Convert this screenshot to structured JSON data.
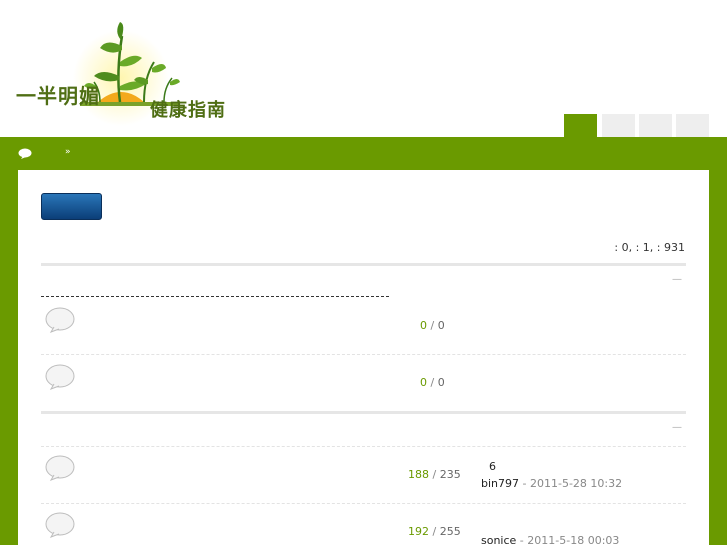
{
  "logo": {
    "text_primary": "一半明媚",
    "text_secondary": "健康指南"
  },
  "nav": {
    "separator": "»"
  },
  "stats": {
    "text": ": 0,   : 1,   : 931"
  },
  "sections": [
    {
      "collapse_label": "—",
      "forums": [
        {
          "topics": "0",
          "posts": "0"
        },
        {
          "topics": "0",
          "posts": "0"
        }
      ]
    },
    {
      "collapse_label": "—",
      "forums": [
        {
          "topics": "188",
          "posts": "235",
          "last_title": "6",
          "last_user": "bin797",
          "last_time": " - 2011-5-28 10:32"
        },
        {
          "topics": "192",
          "posts": "255",
          "last_user": "sonice",
          "last_time": " - 2011-5-18 00:03"
        }
      ]
    }
  ],
  "colors": {
    "brand_green": "#6a9a00",
    "button_blue": "#0b3e78"
  }
}
